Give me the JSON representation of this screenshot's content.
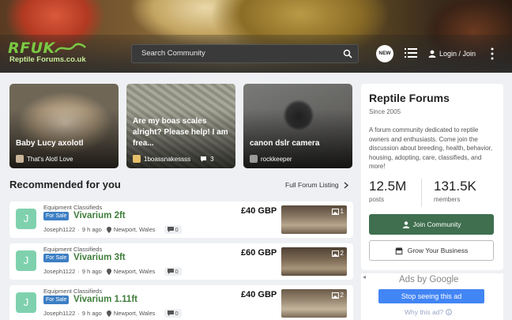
{
  "header": {
    "logo_main": "RFUK",
    "logo_sub": "Reptile Forums.co.uk",
    "search_placeholder": "Search Community",
    "new_badge": "NEW",
    "login_label": "Login / Join"
  },
  "featured": [
    {
      "title": "Baby Lucy axolotl",
      "author": "That's Alotl Love",
      "replies": ""
    },
    {
      "title": "Are my boas scales alright? Please help! I am frea...",
      "author": "1boassnakessss",
      "replies": "3"
    },
    {
      "title": "canon dslr camera",
      "author": "rockkeeper",
      "replies": ""
    }
  ],
  "recommended": {
    "title": "Recommended for you",
    "full_link": "Full Forum Listing",
    "rows": [
      {
        "avatar": "J",
        "category": "Equipment Classifieds",
        "badge": "For Sale",
        "title": "Vivarium 2ft",
        "author": "Joseph1122",
        "time": "9 h ago",
        "location": "Newport, Wales",
        "comments": "0",
        "price": "£40 GBP",
        "photos": "1"
      },
      {
        "avatar": "J",
        "category": "Equipment Classifieds",
        "badge": "For Sale",
        "title": "Vivarium 3ft",
        "author": "Joseph1122",
        "time": "9 h ago",
        "location": "Newport, Wales",
        "comments": "0",
        "price": "£60 GBP",
        "photos": "2"
      },
      {
        "avatar": "J",
        "category": "Equipment Classifieds",
        "badge": "For Sale",
        "title": "Vivarium 1.11ft",
        "author": "Joseph1122",
        "time": "9 h ago",
        "location": "Newport, Wales",
        "comments": "0",
        "price": "£40 GBP",
        "photos": "2"
      }
    ]
  },
  "sidebar": {
    "title": "Reptile Forums",
    "since": "Since 2005",
    "description": "A forum community dedicated to reptile owners and enthusiasts. Come join the discussion about breeding, health, behavior, housing, adopting, care, classifieds, and more!",
    "posts_value": "12.5M",
    "posts_label": "posts",
    "members_value": "131.5K",
    "members_label": "members",
    "join_label": "Join Community",
    "grow_label": "Grow Your Business"
  },
  "ad": {
    "ads_by": "Ads by Google",
    "stop_label": "Stop seeing this ad",
    "why_label": "Why this ad?"
  },
  "colors": {
    "accent_green": "#3f6f4f",
    "title_green": "#3e7d3a",
    "badge_blue": "#3d7fc4",
    "google_blue": "#4285f4"
  }
}
